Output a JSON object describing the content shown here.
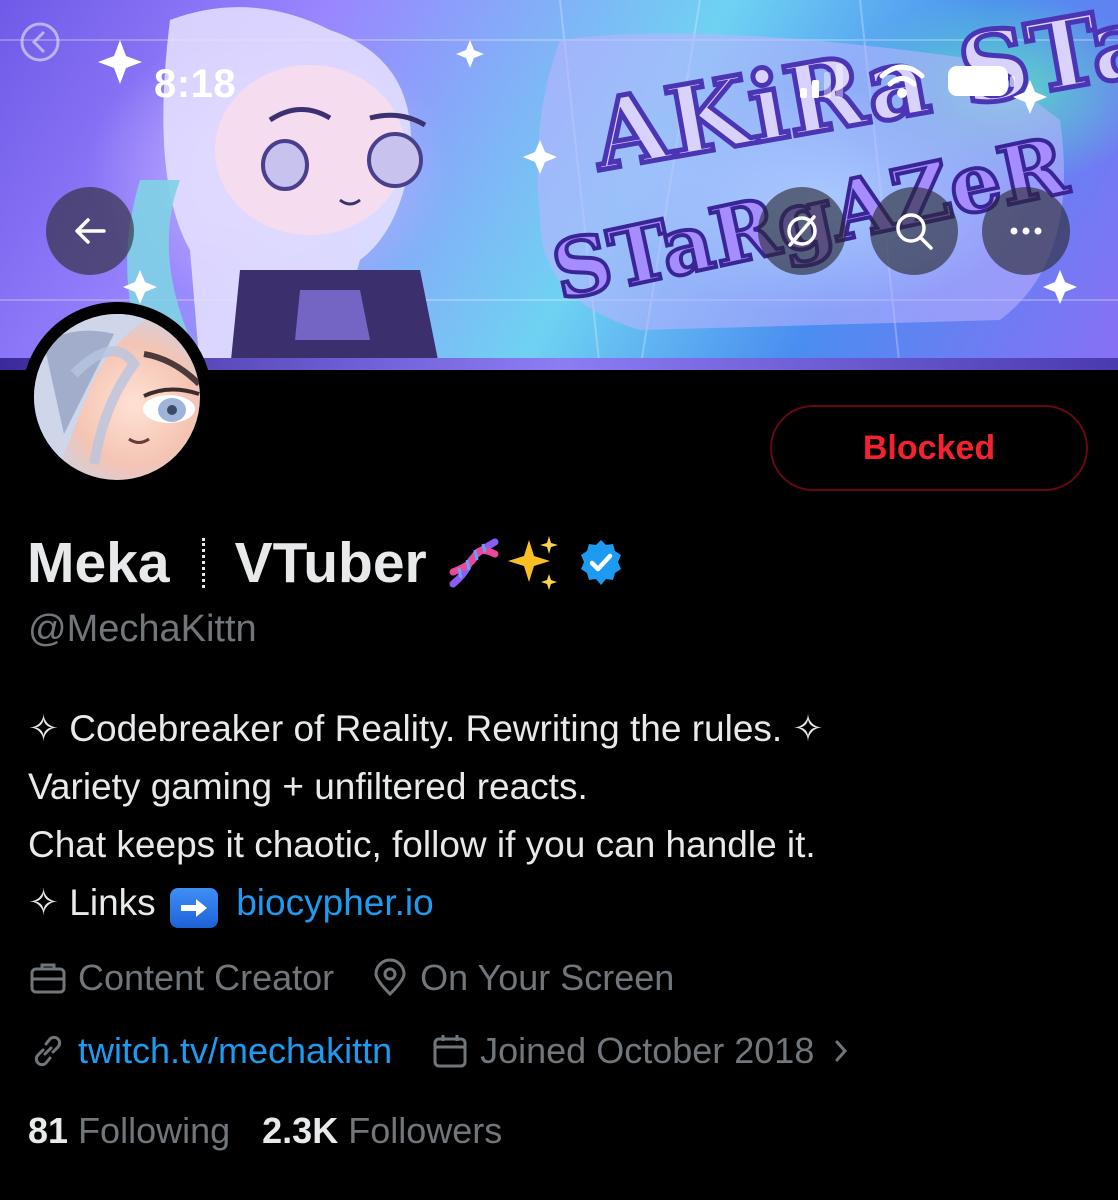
{
  "status_bar": {
    "time": "8:18"
  },
  "banner": {
    "artwork_text": "AKiRa STaRgAZeR"
  },
  "nav": {
    "back_icon": "arrow-left-icon",
    "grok_icon": "grok-icon",
    "search_icon": "search-icon",
    "more_icon": "more-horizontal-icon"
  },
  "action": {
    "blocked_label": "Blocked",
    "color": "#f4212e"
  },
  "profile": {
    "name_first": "Meka",
    "name_second": "VTuber",
    "verified": true,
    "handle": "@MechaKittn",
    "bio": {
      "line1": "✧ Codebreaker of Reality. Rewriting the rules. ✧",
      "line2": "Variety gaming + unfiltered reacts.",
      "line3": "Chat keeps it chaotic, follow if you can handle it.",
      "line4_prefix": "✧ Links",
      "line4_link": "biocypher.io"
    },
    "category": "Content Creator",
    "location": "On Your Screen",
    "website": "twitch.tv/mechakittn",
    "joined": "Joined October 2018",
    "following_count": "81",
    "following_label": "Following",
    "followers_count": "2.3K",
    "followers_label": "Followers"
  },
  "colors": {
    "link": "#1d9bf0",
    "muted": "#71767b",
    "text": "#e7e9ea",
    "verified": "#1d9bf0"
  }
}
